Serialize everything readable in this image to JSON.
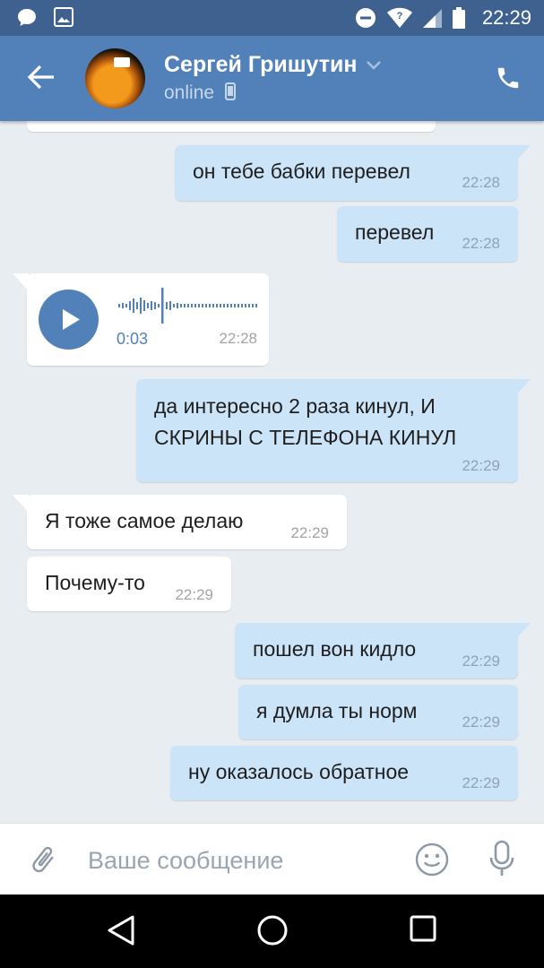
{
  "status_bar": {
    "time": "22:29",
    "icons": [
      "chat-bubble-icon",
      "image-icon",
      "do-not-disturb-icon",
      "wifi-icon",
      "signal-icon",
      "battery-icon"
    ]
  },
  "header": {
    "contact_name": "Сергей Гришутин",
    "status": "online",
    "icons": [
      "back-arrow-icon",
      "chevron-down-icon",
      "mobile-phone-icon",
      "phone-call-icon"
    ]
  },
  "messages": [
    {
      "direction": "out",
      "type": "text",
      "lines": [
        "он тебе бабки перевел"
      ],
      "time": "22:28"
    },
    {
      "direction": "out",
      "type": "text",
      "lines": [
        "перевел"
      ],
      "time": "22:28"
    },
    {
      "direction": "in",
      "type": "voice",
      "duration": "0:03",
      "time": "22:28"
    },
    {
      "direction": "out",
      "type": "text",
      "lines": [
        "да интересно 2 раза кинул, И",
        "СКРИНЫ С ТЕЛЕФОНА КИНУЛ"
      ],
      "time": "22:29"
    },
    {
      "direction": "in",
      "type": "text",
      "lines": [
        "Я тоже самое делаю"
      ],
      "time": "22:29"
    },
    {
      "direction": "in",
      "type": "text",
      "lines": [
        "Почему-то"
      ],
      "time": "22:29"
    },
    {
      "direction": "out",
      "type": "text",
      "lines": [
        "пошел вон кидло"
      ],
      "time": "22:29"
    },
    {
      "direction": "out",
      "type": "text",
      "lines": [
        "я думла ты норм"
      ],
      "time": "22:29"
    },
    {
      "direction": "out",
      "type": "text",
      "lines": [
        "ну оказалось обратное"
      ],
      "time": "22:29"
    }
  ],
  "composer": {
    "placeholder": "Ваше сообщение",
    "value": "",
    "icons": [
      "paperclip-icon",
      "smiley-icon",
      "microphone-icon"
    ]
  },
  "nav_bar": {
    "icons": [
      "back-triangle-icon",
      "home-circle-icon",
      "recents-square-icon"
    ]
  },
  "colors": {
    "status_bar": "#3e618f",
    "header": "#5181b8",
    "chat_background": "#e8edf2",
    "outgoing_bubble": "#cce4f7",
    "incoming_bubble": "#ffffff",
    "accent": "#5181b8"
  }
}
